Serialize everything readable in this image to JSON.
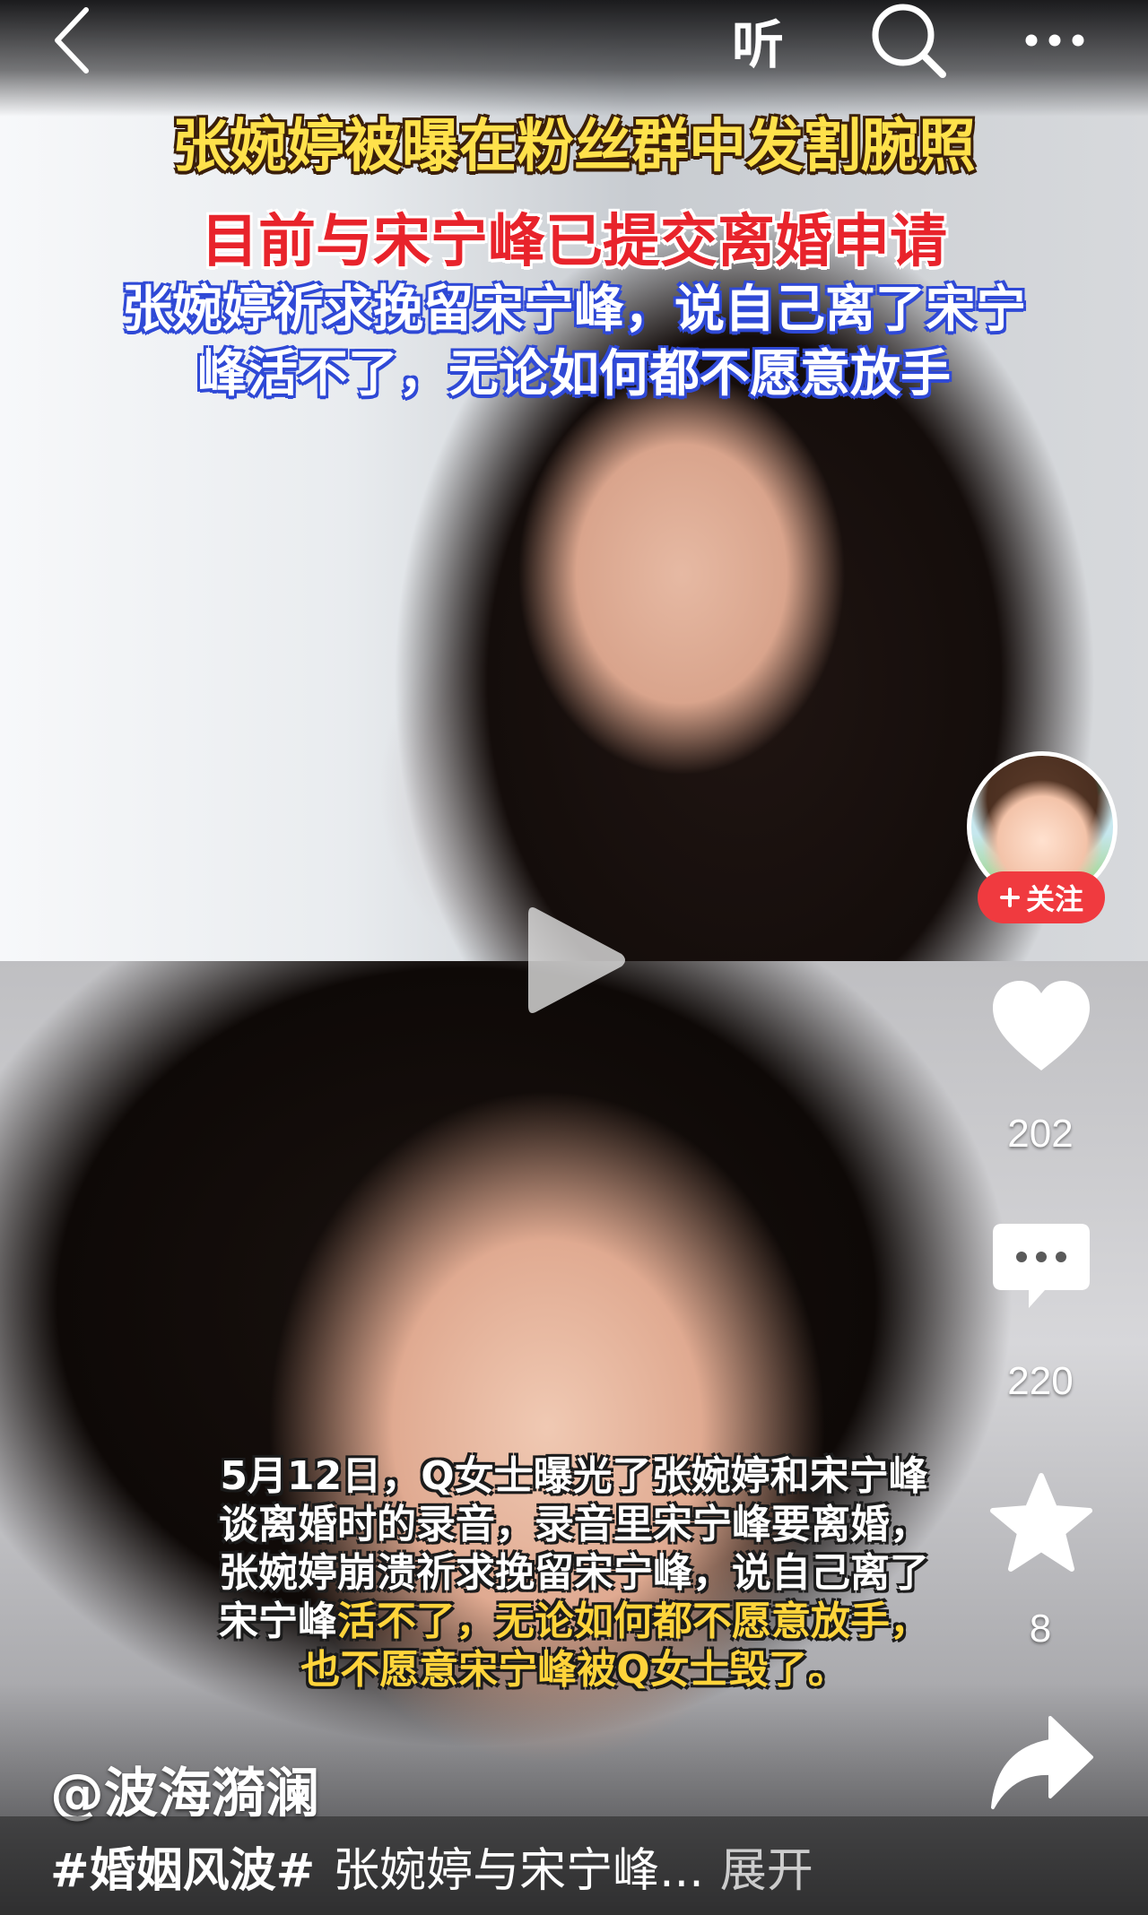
{
  "nav": {
    "listen_label": "听",
    "icons": [
      "back-chevron-icon",
      "search-icon",
      "more-icon"
    ]
  },
  "captions": {
    "top_yellow": "张婉婷被曝在粉丝群中发割腕照",
    "top_red": "目前与宋宁峰已提交离婚申请",
    "top_white_line1": "张婉婷祈求挽留宋宁峰，说自己离了宋宁",
    "top_white_line2": "峰活不了，无论如何都不愿意放手",
    "bottom_line1": "5月12日，Q女士曝光了张婉婷和宋宁峰",
    "bottom_line2": "谈离婚时的录音，录音里宋宁峰要离婚，",
    "bottom_line3": "张婉婷崩溃祈求挽留宋宁峰，说自己离了",
    "bottom_line4_a": "宋宁峰",
    "bottom_line4_b": "活不了，无论如何都不愿意放手，",
    "bottom_line5": "也不愿意宋宁峰被Q女士毁了。"
  },
  "rail": {
    "follow_label": "关注",
    "like_count": "202",
    "comment_count": "220",
    "favorite_count": "8",
    "icons": [
      "heart-icon",
      "comment-icon",
      "star-icon",
      "share-icon"
    ]
  },
  "post": {
    "author": "@波海漪澜",
    "hashtag": "#婚姻风波#",
    "text": "张婉婷与宋宁峰...",
    "expand_label": "展开"
  },
  "colors": {
    "caption_yellow": "#ffe14b",
    "caption_red": "#e8232b",
    "caption_stroke_blue": "#2f49d6",
    "follow_red": "#f03a3f"
  }
}
